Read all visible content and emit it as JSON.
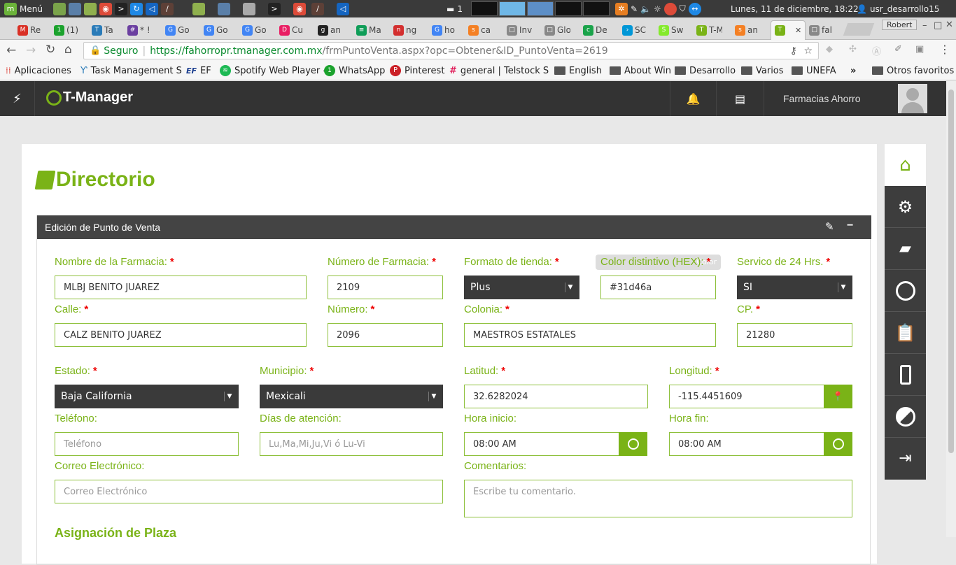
{
  "taskbar": {
    "menu": "Menú",
    "notif_count": "1",
    "datetime": "Lunes, 11 de diciembre, 18:22",
    "user": "usr_desarrollo15"
  },
  "tabs": [
    {
      "label": "Re",
      "color": "#d93025",
      "icon": "M"
    },
    {
      "label": "(1)",
      "color": "#1ba22d",
      "icon": "1"
    },
    {
      "label": "Ta",
      "color": "#2a7bb8",
      "icon": "T"
    },
    {
      "label": "* !",
      "color": "#6b3fa0",
      "icon": "#"
    },
    {
      "label": "Go",
      "color": "#4285f4",
      "icon": "G"
    },
    {
      "label": "Go",
      "color": "#4285f4",
      "icon": "G"
    },
    {
      "label": "Go",
      "color": "#4285f4",
      "icon": "G"
    },
    {
      "label": "Cu",
      "color": "#e91e63",
      "icon": "D"
    },
    {
      "label": "an",
      "color": "#222",
      "icon": "g"
    },
    {
      "label": "Ma",
      "color": "#0f9d58",
      "icon": "≡"
    },
    {
      "label": "ng",
      "color": "#d32f2f",
      "icon": "n"
    },
    {
      "label": "ho",
      "color": "#4285f4",
      "icon": "G"
    },
    {
      "label": "ca",
      "color": "#f48024",
      "icon": "s"
    },
    {
      "label": "Inv",
      "color": "#888",
      "icon": "□"
    },
    {
      "label": "Glo",
      "color": "#888",
      "icon": "□"
    },
    {
      "label": "De",
      "color": "#1aa34a",
      "icon": "c"
    },
    {
      "label": "SC",
      "color": "#0097d7",
      "icon": "›"
    },
    {
      "label": "Sw",
      "color": "#85ea2d",
      "icon": "S"
    },
    {
      "label": "T-M",
      "color": "#7ab317",
      "icon": "T"
    },
    {
      "label": "an",
      "color": "#f48024",
      "icon": "s"
    },
    {
      "label": "",
      "color": "#7ab317",
      "icon": "T"
    },
    {
      "label": "fal",
      "color": "#888",
      "icon": "□"
    }
  ],
  "window": {
    "profile": "Robert"
  },
  "address": {
    "secure_label": "Seguro",
    "url_host": "https://fahorropr.tmanager.com.mx",
    "url_path": "/frmPuntoVenta.aspx?opc=Obtener&ID_PuntoVenta=2619"
  },
  "bookmarks": [
    {
      "label": "Aplicaciones",
      "icon": "apps-icon"
    },
    {
      "label": "Task Management S",
      "icon": "task-icon"
    },
    {
      "label": "EF",
      "icon": "ef-icon"
    },
    {
      "label": "Spotify Web Player -",
      "icon": "spotify-icon"
    },
    {
      "label": "WhatsApp",
      "icon": "whatsapp-icon"
    },
    {
      "label": "Pinterest",
      "icon": "pinterest-icon"
    },
    {
      "label": "general | Telstock S",
      "icon": "slack-icon"
    },
    {
      "label": "English",
      "icon": "folder-icon"
    },
    {
      "label": "About Win",
      "icon": "folder-icon"
    },
    {
      "label": "Desarrollo",
      "icon": "folder-icon"
    },
    {
      "label": "Varios",
      "icon": "folder-icon"
    },
    {
      "label": "UNEFA",
      "icon": "folder-icon"
    },
    {
      "label": "»",
      "icon": ""
    },
    {
      "label": "Otros favoritos",
      "icon": "folder-icon"
    }
  ],
  "app": {
    "brand": "T-Manager",
    "company": "Farmacias Ahorro"
  },
  "page": {
    "title": "Directorio",
    "panel_title": "Edición de Punto de Venta",
    "section_next": "Asignación de Plaza"
  },
  "form": {
    "nombre": {
      "label": "Nombre de la Farmacia:",
      "value": "MLBJ BENITO JUAREZ"
    },
    "numero_farmacia": {
      "label": "Número de Farmacia:",
      "value": "2109"
    },
    "formato": {
      "label": "Formato de tienda:",
      "value": "Plus"
    },
    "color": {
      "label": "Color distintivo (HEX):",
      "value": "#31d46a",
      "tooltip": "Color"
    },
    "servicio24": {
      "label": "Servico de 24 Hrs.",
      "value": "SI"
    },
    "calle": {
      "label": "Calle:",
      "value": "CALZ BENITO JUAREZ"
    },
    "numero": {
      "label": "Número:",
      "value": "2096"
    },
    "colonia": {
      "label": "Colonia:",
      "value": "MAESTROS ESTATALES"
    },
    "cp": {
      "label": "CP.",
      "value": "21280"
    },
    "estado": {
      "label": "Estado:",
      "value": "Baja California"
    },
    "municipio": {
      "label": "Municipio:",
      "value": "Mexicali"
    },
    "latitud": {
      "label": "Latitud:",
      "value": "32.6282024"
    },
    "longitud": {
      "label": "Longitud:",
      "value": "-115.4451609"
    },
    "telefono": {
      "label": "Teléfono:",
      "placeholder": "Teléfono"
    },
    "dias": {
      "label": "Días de atención:",
      "placeholder": "Lu,Ma,Mi,Ju,Vi  ó  Lu-Vi"
    },
    "hora_inicio": {
      "label": "Hora inicio:",
      "value": "08:00 AM"
    },
    "hora_fin": {
      "label": "Hora fin:",
      "value": "08:00 AM"
    },
    "correo": {
      "label": "Correo Electrónico:",
      "placeholder": "Correo Electrónico"
    },
    "comentarios": {
      "label": "Comentarios:",
      "placeholder": "Escribe tu comentario."
    }
  },
  "colors": {
    "accent": "#7ab317",
    "dark": "#333333",
    "required": "#e00000"
  }
}
